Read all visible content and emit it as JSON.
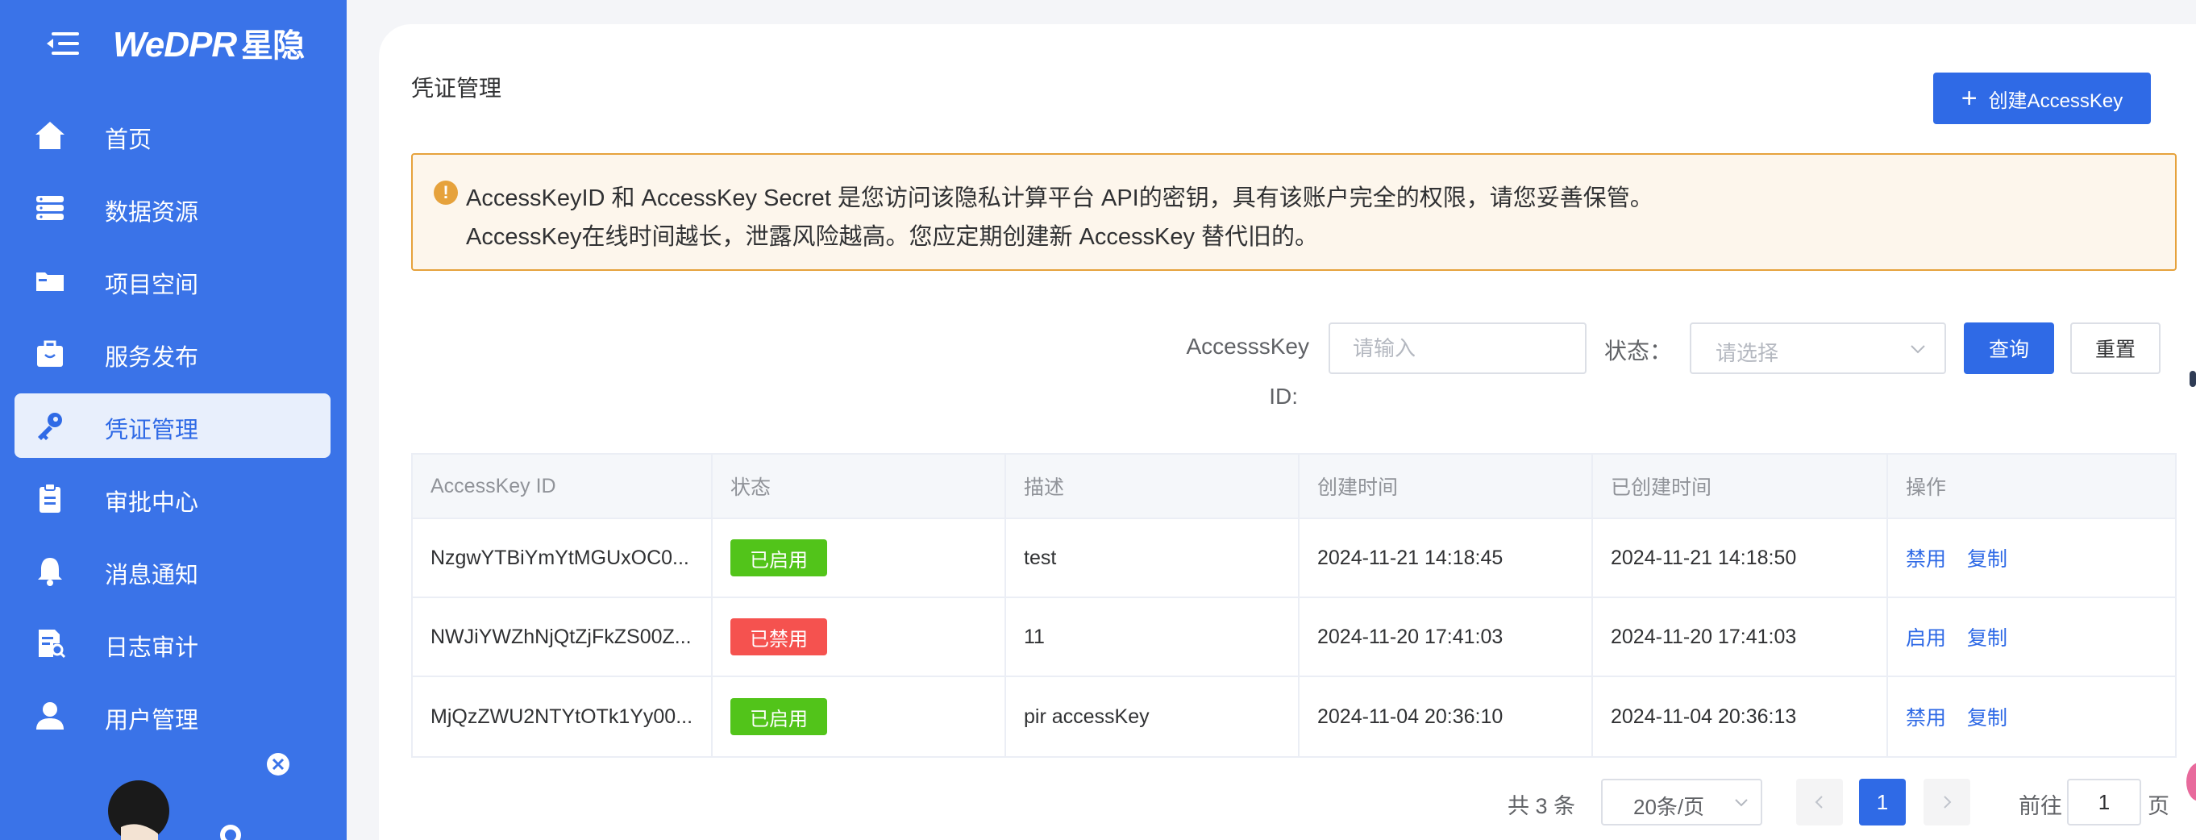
{
  "brand": {
    "logo_text": "WeDPR",
    "logo_cn": "星隐"
  },
  "sidebar": {
    "items": [
      {
        "label": "首页",
        "icon": "home-icon"
      },
      {
        "label": "数据资源",
        "icon": "database-icon"
      },
      {
        "label": "项目空间",
        "icon": "folder-icon"
      },
      {
        "label": "服务发布",
        "icon": "briefcase-icon"
      },
      {
        "label": "凭证管理",
        "icon": "key-icon",
        "active": true
      },
      {
        "label": "审批中心",
        "icon": "clipboard-icon"
      },
      {
        "label": "消息通知",
        "icon": "bell-icon"
      },
      {
        "label": "日志审计",
        "icon": "log-search-icon"
      },
      {
        "label": "用户管理",
        "icon": "user-icon"
      }
    ]
  },
  "page": {
    "title": "凭证管理",
    "create_button": "创建AccessKey"
  },
  "alert": {
    "line1": "AccessKeyID 和 AccessKey Secret 是您访问该隐私计算平台 API的密钥，具有该账户完全的权限，请您妥善保管。",
    "line2": "AccessKey在线时间越长，泄露风险越高。您应定期创建新 AccessKey 替代旧的。"
  },
  "filter": {
    "id_label_1": "AccesssKey",
    "id_label_2": "ID:",
    "id_placeholder": "请输入",
    "status_label": "状态：",
    "status_placeholder": "请选择",
    "query_button": "查询",
    "reset_button": "重置"
  },
  "table": {
    "headers": [
      "AccessKey ID",
      "状态",
      "描述",
      "创建时间",
      "已创建时间",
      "操作"
    ],
    "rows": [
      {
        "id": "NzgwYTBiYmYtMGUxOC0...",
        "status": "已启用",
        "status_color": "#52c41a",
        "desc": "test",
        "created": "2024-11-21 14:18:45",
        "elapsed": "2024-11-21 14:18:50",
        "action1": "禁用",
        "action2": "复制"
      },
      {
        "id": "NWJiYWZhNjQtZjFkZS00Z...",
        "status": "已禁用",
        "status_color": "#f5524f",
        "desc": "11",
        "created": "2024-11-20 17:41:03",
        "elapsed": "2024-11-20 17:41:03",
        "action1": "启用",
        "action2": "复制"
      },
      {
        "id": "MjQzZWU2NTYtOTk1Yy00...",
        "status": "已启用",
        "status_color": "#52c41a",
        "desc": "pir accessKey",
        "created": "2024-11-04 20:36:10",
        "elapsed": "2024-11-04 20:36:13",
        "action1": "禁用",
        "action2": "复制"
      }
    ]
  },
  "pagination": {
    "total": "共 3 条",
    "page_size": "20条/页",
    "current": "1",
    "goto_label": "前往",
    "goto_value": "1",
    "page_suffix": "页"
  }
}
